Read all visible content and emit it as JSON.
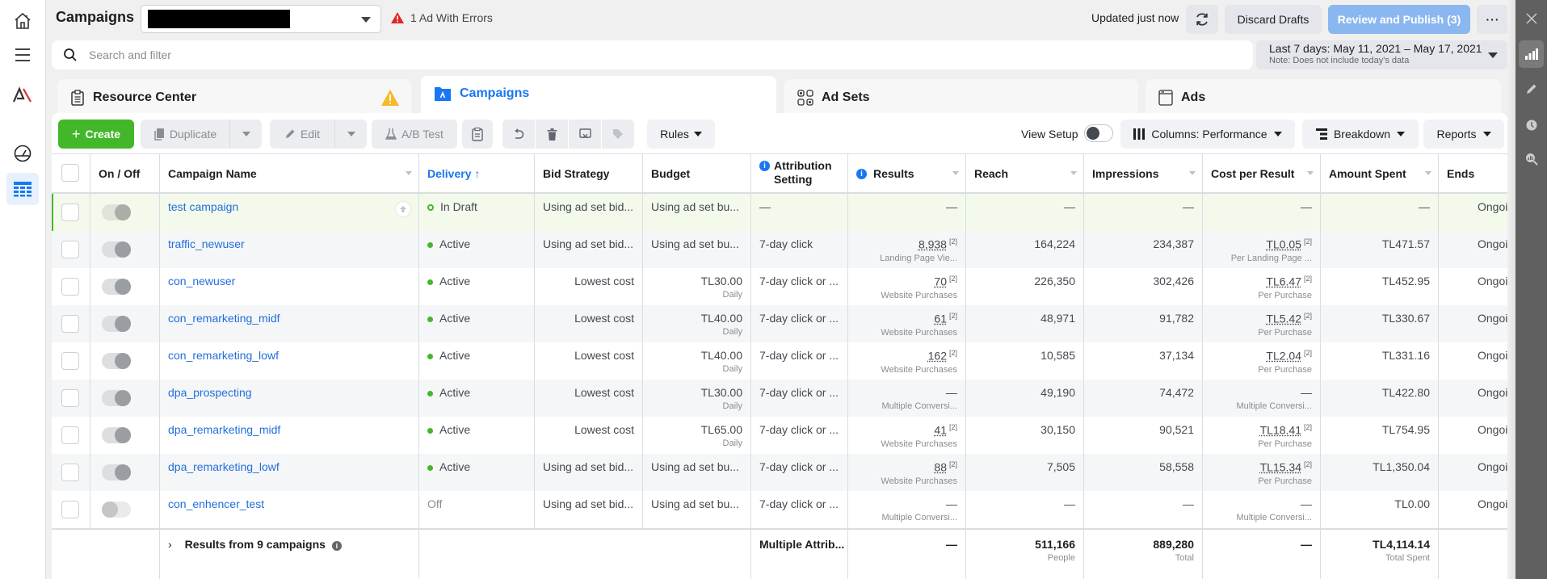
{
  "header": {
    "title": "Campaigns",
    "errors_label": "1 Ad With Errors",
    "updated_label": "Updated just now",
    "discard_label": "Discard Drafts",
    "publish_label": "Review and Publish (3)",
    "more_label": "···"
  },
  "search": {
    "placeholder": "Search and filter",
    "value": ""
  },
  "date_range": {
    "label": "Last 7 days: May 11, 2021 – May 17, 2021",
    "note": "Note: Does not include today's data"
  },
  "tabs": [
    {
      "label": "Resource Center"
    },
    {
      "label": "Campaigns"
    },
    {
      "label": "Ad Sets"
    },
    {
      "label": "Ads"
    }
  ],
  "toolbar": {
    "create": "Create",
    "duplicate": "Duplicate",
    "edit": "Edit",
    "ab_test": "A/B Test",
    "rules": "Rules",
    "view_setup": "View Setup",
    "columns": "Columns: Performance",
    "breakdown": "Breakdown",
    "reports": "Reports"
  },
  "columns": {
    "onoff": "On / Off",
    "name": "Campaign Name",
    "delivery": "Delivery ↑",
    "bid": "Bid Strategy",
    "budget": "Budget",
    "attribution": "Attribution Setting",
    "results": "Results",
    "reach": "Reach",
    "impressions": "Impressions",
    "cpr": "Cost per Result",
    "spent": "Amount Spent",
    "ends": "Ends"
  },
  "rows": [
    {
      "name": "test campaign",
      "delivery": "In Draft",
      "bid": "Using ad set bid...",
      "budget": "Using ad set bu...",
      "budget_sub": "",
      "attribution": "—",
      "results": "—",
      "results_sub": "",
      "reach": "—",
      "impressions": "—",
      "cpr": "—",
      "cpr_sub": "",
      "spent": "—",
      "ends": "Ongoing"
    },
    {
      "name": "traffic_newuser",
      "delivery": "Active",
      "bid": "Using ad set bid...",
      "budget": "Using ad set bu...",
      "budget_sub": "",
      "attribution": "7-day click",
      "results": "8,938",
      "results_sub": "Landing Page Vie...",
      "reach": "164,224",
      "impressions": "234,387",
      "cpr": "TL0.05",
      "cpr_sub": "Per Landing Page ...",
      "spent": "TL471.57",
      "ends": "Ongoing"
    },
    {
      "name": "con_newuser",
      "delivery": "Active",
      "bid": "Lowest cost",
      "budget": "TL30.00",
      "budget_sub": "Daily",
      "attribution": "7-day click or ...",
      "results": "70",
      "results_sub": "Website Purchases",
      "reach": "226,350",
      "impressions": "302,426",
      "cpr": "TL6.47",
      "cpr_sub": "Per Purchase",
      "spent": "TL452.95",
      "ends": "Ongoing"
    },
    {
      "name": "con_remarketing_midf",
      "delivery": "Active",
      "bid": "Lowest cost",
      "budget": "TL40.00",
      "budget_sub": "Daily",
      "attribution": "7-day click or ...",
      "results": "61",
      "results_sub": "Website Purchases",
      "reach": "48,971",
      "impressions": "91,782",
      "cpr": "TL5.42",
      "cpr_sub": "Per Purchase",
      "spent": "TL330.67",
      "ends": "Ongoing"
    },
    {
      "name": "con_remarketing_lowf",
      "delivery": "Active",
      "bid": "Lowest cost",
      "budget": "TL40.00",
      "budget_sub": "Daily",
      "attribution": "7-day click or ...",
      "results": "162",
      "results_sub": "Website Purchases",
      "reach": "10,585",
      "impressions": "37,134",
      "cpr": "TL2.04",
      "cpr_sub": "Per Purchase",
      "spent": "TL331.16",
      "ends": "Ongoing"
    },
    {
      "name": "dpa_prospecting",
      "delivery": "Active",
      "bid": "Lowest cost",
      "budget": "TL30.00",
      "budget_sub": "Daily",
      "attribution": "7-day click or ...",
      "results": "—",
      "results_sub": "Multiple Conversi...",
      "reach": "49,190",
      "impressions": "74,472",
      "cpr": "—",
      "cpr_sub": "Multiple Conversi...",
      "spent": "TL422.80",
      "ends": "Ongoing"
    },
    {
      "name": "dpa_remarketing_midf",
      "delivery": "Active",
      "bid": "Lowest cost",
      "budget": "TL65.00",
      "budget_sub": "Daily",
      "attribution": "7-day click or ...",
      "results": "41",
      "results_sub": "Website Purchases",
      "reach": "30,150",
      "impressions": "90,521",
      "cpr": "TL18.41",
      "cpr_sub": "Per Purchase",
      "spent": "TL754.95",
      "ends": "Ongoing"
    },
    {
      "name": "dpa_remarketing_lowf",
      "delivery": "Active",
      "bid": "Using ad set bid...",
      "budget": "Using ad set bu...",
      "budget_sub": "",
      "attribution": "7-day click or ...",
      "results": "88",
      "results_sub": "Website Purchases",
      "reach": "7,505",
      "impressions": "58,558",
      "cpr": "TL15.34",
      "cpr_sub": "Per Purchase",
      "spent": "TL1,350.04",
      "ends": "Ongoing"
    },
    {
      "name": "con_enhencer_test",
      "delivery": "Off",
      "bid": "Using ad set bid...",
      "budget": "Using ad set bu...",
      "budget_sub": "",
      "attribution": "7-day click or ...",
      "results": "—",
      "results_sub": "Multiple Conversi...",
      "reach": "—",
      "impressions": "—",
      "cpr": "—",
      "cpr_sub": "Multiple Conversi...",
      "spent": "TL0.00",
      "ends": "Ongoing"
    }
  ],
  "footnote_marker": "[2]",
  "summary": {
    "label": "Results from 9 campaigns",
    "attribution": "Multiple Attrib...",
    "results": "—",
    "reach": "511,166",
    "reach_sub": "People",
    "impressions": "889,280",
    "impressions_sub": "Total",
    "cpr": "—",
    "spent": "TL4,114.14",
    "spent_sub": "Total Spent"
  },
  "colors": {
    "accent": "#1877f2",
    "create_green": "#42b72a",
    "active_dot": "#42b72a",
    "warning_red": "#e02424",
    "warning_yellow": "#f7b928",
    "publish_disabled": "#8bb7f0",
    "link_blue": "#216fdb"
  }
}
